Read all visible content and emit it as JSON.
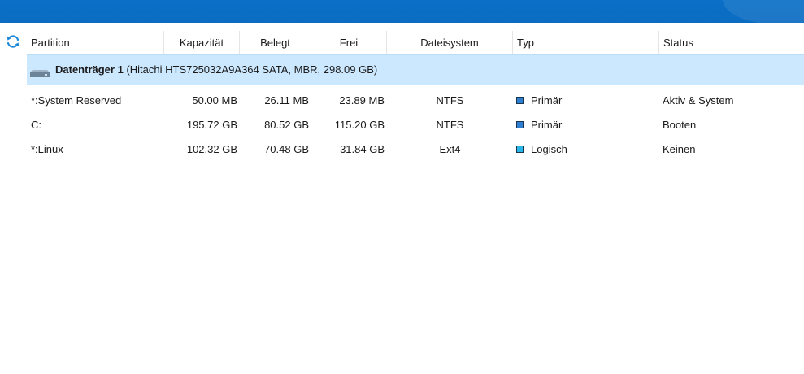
{
  "columns": {
    "partition": "Partition",
    "capacity": "Kapazität",
    "used": "Belegt",
    "free": "Frei",
    "filesystem": "Dateisystem",
    "type": "Typ",
    "status": "Status"
  },
  "disk": {
    "name": "Datenträger 1",
    "details": "(Hitachi HTS725032A9A364 SATA, MBR, 298.09 GB)"
  },
  "partitions": [
    {
      "name": "*:System Reserved",
      "capacity": "50.00 MB",
      "used": "26.11 MB",
      "free": "23.89 MB",
      "filesystem": "NTFS",
      "type": "Primär",
      "type_color": "#2e7fd0",
      "status": "Aktiv & System"
    },
    {
      "name": "C:",
      "capacity": "195.72 GB",
      "used": "80.52 GB",
      "free": "115.20 GB",
      "filesystem": "NTFS",
      "type": "Primär",
      "type_color": "#2e7fd0",
      "status": "Booten"
    },
    {
      "name": "*:Linux",
      "capacity": "102.32 GB",
      "used": "70.48 GB",
      "free": "31.84 GB",
      "filesystem": "Ext4",
      "type": "Logisch",
      "type_color": "#27b6e6",
      "status": "Keinen"
    }
  ],
  "colors": {
    "topbar": "#0b6cc2",
    "selected_row": "#cce8ff",
    "refresh_icon": "#1e88d8"
  },
  "icons": {
    "refresh": "refresh-icon",
    "disk": "hard-disk-icon"
  }
}
